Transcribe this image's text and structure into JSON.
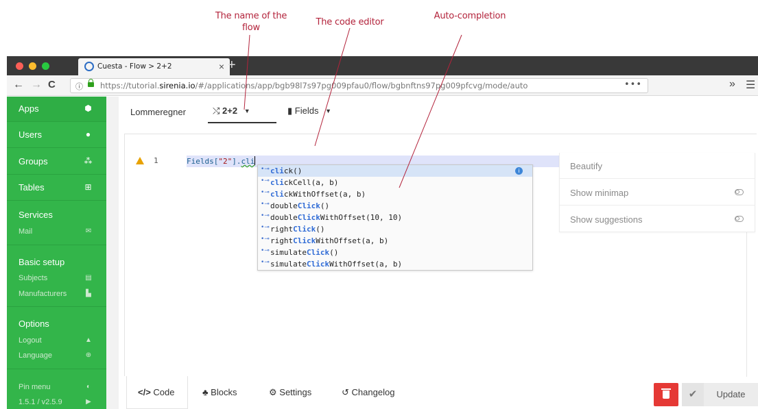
{
  "annotations": {
    "flow_name": "The name of the flow",
    "code_editor": "The code editor",
    "autocompletion": "Auto-completion"
  },
  "browser": {
    "tab_title": "Cuesta - Flow > 2+2",
    "tab_close": "×",
    "new_tab": "+",
    "info_glyph": "ⓘ",
    "url_prefix": "https://tutorial.",
    "url_domain": "sirenia.io",
    "url_path": "/#/applications/app/bgb98l7s97pg009pfau0/flow/bgbnftns97pg009pfcvg/mode/auto",
    "url_more": "•••",
    "overflow": "»",
    "menu": "☰",
    "back": "←",
    "forward": "→",
    "reload": "C",
    "colors": {
      "close": "#fc5f57",
      "minimize": "#fdbc2e",
      "maximize": "#28c840"
    }
  },
  "sidebar": {
    "accent": "#33b54a",
    "items": [
      {
        "label": "Apps",
        "icon": "cube-icon",
        "glyph": "⬢"
      },
      {
        "label": "Users",
        "icon": "user-icon",
        "glyph": "●"
      },
      {
        "label": "Groups",
        "icon": "group-icon",
        "glyph": "⁂"
      },
      {
        "label": "Tables",
        "icon": "table-icon",
        "glyph": "⊞"
      }
    ],
    "services": {
      "title": "Services",
      "items": [
        {
          "label": "Mail",
          "icon": "mail-icon",
          "glyph": "✉"
        }
      ]
    },
    "basic_setup": {
      "title": "Basic setup",
      "items": [
        {
          "label": "Subjects",
          "icon": "book-icon",
          "glyph": "▤"
        },
        {
          "label": "Manufacturers",
          "icon": "factory-icon",
          "glyph": "▙"
        }
      ]
    },
    "options": {
      "title": "Options",
      "items": [
        {
          "label": "Logout",
          "icon": "lock-icon",
          "glyph": "▲"
        },
        {
          "label": "Language",
          "icon": "globe-icon",
          "glyph": "⊕"
        }
      ]
    },
    "footer": [
      {
        "label": "Pin menu",
        "icon": "toggle-icon",
        "glyph": "◐"
      },
      {
        "label": "1.5.1 / v2.5.9",
        "icon": "flag-icon",
        "glyph": "▶"
      }
    ]
  },
  "tabs": {
    "app": "Lommeregner",
    "flow": "2+2",
    "flow_icon": "⤭",
    "fields": "Fields",
    "fields_icon": "▮",
    "caret": "▼"
  },
  "editor": {
    "line_number": "1",
    "code_prefix": "Fields[",
    "code_string": "\"2\"",
    "code_mid": "].",
    "code_tail": "cli",
    "suggestions": [
      {
        "pre": "",
        "match": "cli",
        "post": "ck()"
      },
      {
        "pre": "",
        "match": "cli",
        "post": "ckCell(a, b)"
      },
      {
        "pre": "",
        "match": "cli",
        "post": "ckWithOffset(a, b)"
      },
      {
        "pre": "double",
        "match": "Click",
        "post": "()"
      },
      {
        "pre": "double",
        "match": "Click",
        "post": "WithOffset(10, 10)"
      },
      {
        "pre": "right",
        "match": "Click",
        "post": "()"
      },
      {
        "pre": "right",
        "match": "Click",
        "post": "WithOffset(a, b)"
      },
      {
        "pre": "simulate",
        "match": "Click",
        "post": "()"
      },
      {
        "pre": "simulate",
        "match": "Click",
        "post": "WithOffset(a, b)"
      }
    ],
    "suggestion_kind": "•⊸",
    "info_icon": "i"
  },
  "panel": {
    "beautify": "Beautify",
    "minimap": "Show minimap",
    "suggestions": "Show suggestions"
  },
  "bottom_tabs": {
    "code": "Code",
    "code_icon": "</>",
    "blocks": "Blocks",
    "blocks_icon": "♣",
    "settings": "Settings",
    "settings_icon": "⚙",
    "changelog": "Changelog",
    "changelog_icon": "↺"
  },
  "actions": {
    "delete_color": "#e53935",
    "check": "✔",
    "update": "Update"
  }
}
